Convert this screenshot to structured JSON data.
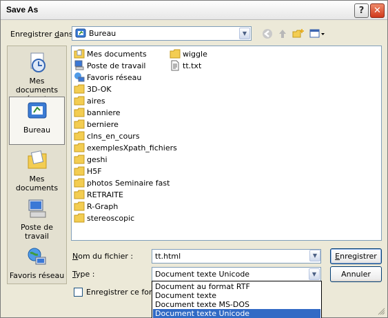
{
  "window": {
    "title": "Save As"
  },
  "lookin": {
    "label_prefix": "Enregistrer ",
    "label_underlined": "d",
    "label_suffix": "ans :",
    "value": "Bureau"
  },
  "places": [
    {
      "label": "Mes documents récents"
    },
    {
      "label": "Bureau"
    },
    {
      "label": "Mes documents"
    },
    {
      "label": "Poste de travail"
    },
    {
      "label": "Favoris réseau"
    }
  ],
  "files_col1": [
    "Mes documents",
    "Poste de travail",
    "Favoris réseau",
    "3D-OK",
    "aires",
    "banniere",
    "berniere",
    "clns_en_cours",
    "exemplesXpath_fichiers",
    "geshi",
    "H5F",
    "photos Seminaire fast",
    "RETRAITE",
    "R-Graph",
    "stereoscopic"
  ],
  "files_col2": [
    "wiggle",
    "tt.txt"
  ],
  "filename": {
    "label_underlined": "N",
    "label_rest": "om du fichier :",
    "value": "tt.html"
  },
  "filetype": {
    "label_underlined": "T",
    "label_rest": "ype :",
    "value": "Document texte Unicode"
  },
  "buttons": {
    "save_underlined": "E",
    "save_rest": "nregistrer",
    "cancel": "Annuler"
  },
  "checkbox": {
    "label_prefix": "Enregistrer ce format"
  },
  "type_options": [
    "Document au format RTF",
    "Document texte",
    "Document texte MS-DOS",
    "Document texte Unicode"
  ],
  "type_selected_index": 3
}
